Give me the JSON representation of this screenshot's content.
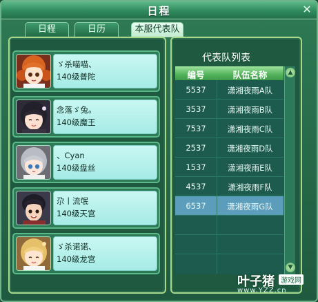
{
  "window": {
    "title": "日程"
  },
  "tabs": [
    {
      "label": "日程",
      "active": false
    },
    {
      "label": "日历",
      "active": false
    },
    {
      "label": "本服代表队",
      "active": true
    }
  ],
  "players": [
    {
      "name": "ゞ杀喵喵、",
      "level_class": "140级普陀",
      "avatar": "orange-hair-girl-avatar"
    },
    {
      "name": "念落ゞ兔。",
      "level_class": "140级魔王",
      "avatar": "dark-hair-girl-avatar"
    },
    {
      "name": "、Cyan",
      "level_class": "140级盘丝",
      "avatar": "silver-hair-girl-avatar"
    },
    {
      "name": "尕丨流氓",
      "level_class": "140级天宫",
      "avatar": "dark-hair-boy-avatar"
    },
    {
      "name": "ゞ杀诺诺、",
      "level_class": "140级龙宫",
      "avatar": "blonde-girl-avatar"
    }
  ],
  "team_list": {
    "title": "代表队列表",
    "headers": [
      "编号",
      "队伍名称"
    ],
    "rows": [
      {
        "id": "5537",
        "name": "潇湘夜雨A队",
        "selected": false
      },
      {
        "id": "3537",
        "name": "潇湘夜雨B队",
        "selected": false
      },
      {
        "id": "7537",
        "name": "潇湘夜雨C队",
        "selected": false
      },
      {
        "id": "2537",
        "name": "潇湘夜雨D队",
        "selected": false
      },
      {
        "id": "1537",
        "name": "潇湘夜雨E队",
        "selected": false
      },
      {
        "id": "4537",
        "name": "潇湘夜雨F队",
        "selected": false
      },
      {
        "id": "6537",
        "name": "潇湘夜雨G队",
        "selected": true
      }
    ]
  },
  "watermark": {
    "main": "叶子猪",
    "tag": "游戏网",
    "url": "www.YZZ.cn"
  },
  "colors": {
    "panel_border": "#a8d98a",
    "info_bg": "#bdf3ee",
    "selected_row": "#5c9dbb"
  }
}
